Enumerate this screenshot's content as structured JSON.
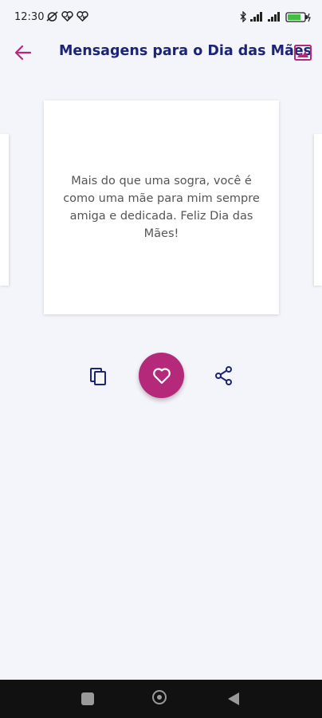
{
  "status_bar": {
    "time": "12:30",
    "left_icons": [
      "alarm-off-icon",
      "heart-pulse-icon",
      "heart-pulse-icon"
    ],
    "right_icons": [
      "bluetooth-icon",
      "signal-icon",
      "signal-icon",
      "battery-charging-icon"
    ]
  },
  "app_bar": {
    "back_icon": "arrow-left-icon",
    "title": "Mensagens para o Dia das Mães",
    "gallery_icon": "image-icon"
  },
  "card": {
    "message": "Mais do que uma sogra, você é como uma mãe para mim sempre amiga e dedicada. Feliz Dia das Mães!"
  },
  "actions": {
    "copy_icon": "copy-icon",
    "favorite_icon": "heart-outline-icon",
    "share_icon": "share-icon"
  },
  "nav_bar": {
    "items": [
      "recents-icon",
      "home-icon",
      "back-icon"
    ]
  },
  "colors": {
    "accent": "#b5297b",
    "title": "#1b2476",
    "background": "#f4f5fa",
    "icon_dark": "#1b2476"
  }
}
